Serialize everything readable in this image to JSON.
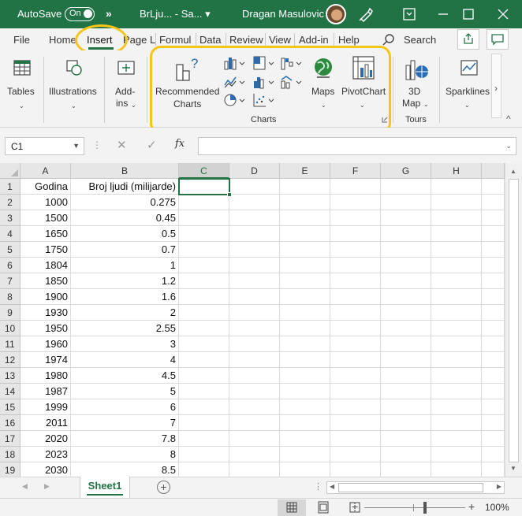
{
  "titlebar": {
    "autosave_label": "AutoSave",
    "autosave_state": "On",
    "more_glyph": "»",
    "filename": "BrLju... - Sa... ▾",
    "username": "Dragan Masulovic",
    "icons": [
      "pen-icon",
      "ribbon-display-icon",
      "minimize-icon",
      "maximize-icon",
      "close-icon"
    ]
  },
  "tabs": {
    "items": [
      "File",
      "Home",
      "Insert",
      "Page L",
      "Formul",
      "Data",
      "Review",
      "View",
      "Add-in",
      "Help"
    ],
    "active": "Insert",
    "search_label": "Search"
  },
  "ribbon": {
    "tables_label": "Tables",
    "illustrations_label": "Illustrations",
    "addins_label_1": "Add-",
    "addins_label_2": "ins",
    "recommended_label_1": "Recommended",
    "recommended_label_2": "Charts",
    "maps_label": "Maps",
    "pivotchart_label": "PivotChart",
    "charts_group_title": "Charts",
    "map3d_label_1": "3D",
    "map3d_label_2": "Map",
    "tours_group_title": "Tours",
    "sparklines_label": "Sparklines",
    "scroll_right_glyph": "›",
    "collapse_glyph": "^",
    "accent_color": "#217346",
    "highlight_color": "#f5c518"
  },
  "formula_bar": {
    "namebox_value": "C1",
    "cancel_glyph": "✕",
    "enter_glyph": "✓",
    "fx_label": "fx",
    "formula_value": ""
  },
  "grid": {
    "columns": [
      "A",
      "B",
      "C",
      "D",
      "E",
      "F",
      "G",
      "H"
    ],
    "selected_column": "C",
    "active_cell": "C1",
    "rows": [
      {
        "num": "1",
        "a": "Godina",
        "b": "Broj ljudi (milijarde)"
      },
      {
        "num": "2",
        "a": "1000",
        "b": "0.275"
      },
      {
        "num": "3",
        "a": "1500",
        "b": "0.45"
      },
      {
        "num": "4",
        "a": "1650",
        "b": "0.5"
      },
      {
        "num": "5",
        "a": "1750",
        "b": "0.7"
      },
      {
        "num": "6",
        "a": "1804",
        "b": "1"
      },
      {
        "num": "7",
        "a": "1850",
        "b": "1.2"
      },
      {
        "num": "8",
        "a": "1900",
        "b": "1.6"
      },
      {
        "num": "9",
        "a": "1930",
        "b": "2"
      },
      {
        "num": "10",
        "a": "1950",
        "b": "2.55"
      },
      {
        "num": "11",
        "a": "1960",
        "b": "3"
      },
      {
        "num": "12",
        "a": "1974",
        "b": "4"
      },
      {
        "num": "13",
        "a": "1980",
        "b": "4.5"
      },
      {
        "num": "14",
        "a": "1987",
        "b": "5"
      },
      {
        "num": "15",
        "a": "1999",
        "b": "6"
      },
      {
        "num": "16",
        "a": "2011",
        "b": "7"
      },
      {
        "num": "17",
        "a": "2020",
        "b": "7.8"
      },
      {
        "num": "18",
        "a": "2023",
        "b": "8"
      },
      {
        "num": "19",
        "a": "2030",
        "b": "8.5"
      }
    ]
  },
  "sheets": {
    "tabs": [
      "Sheet1"
    ],
    "add_glyph": "+",
    "nav_prev_glyph": "◀",
    "nav_next_glyph": "▶",
    "dots_glyph": "⋮"
  },
  "statusbar": {
    "zoom_minus": "−",
    "zoom_plus": "+",
    "zoom_level": "100%"
  }
}
